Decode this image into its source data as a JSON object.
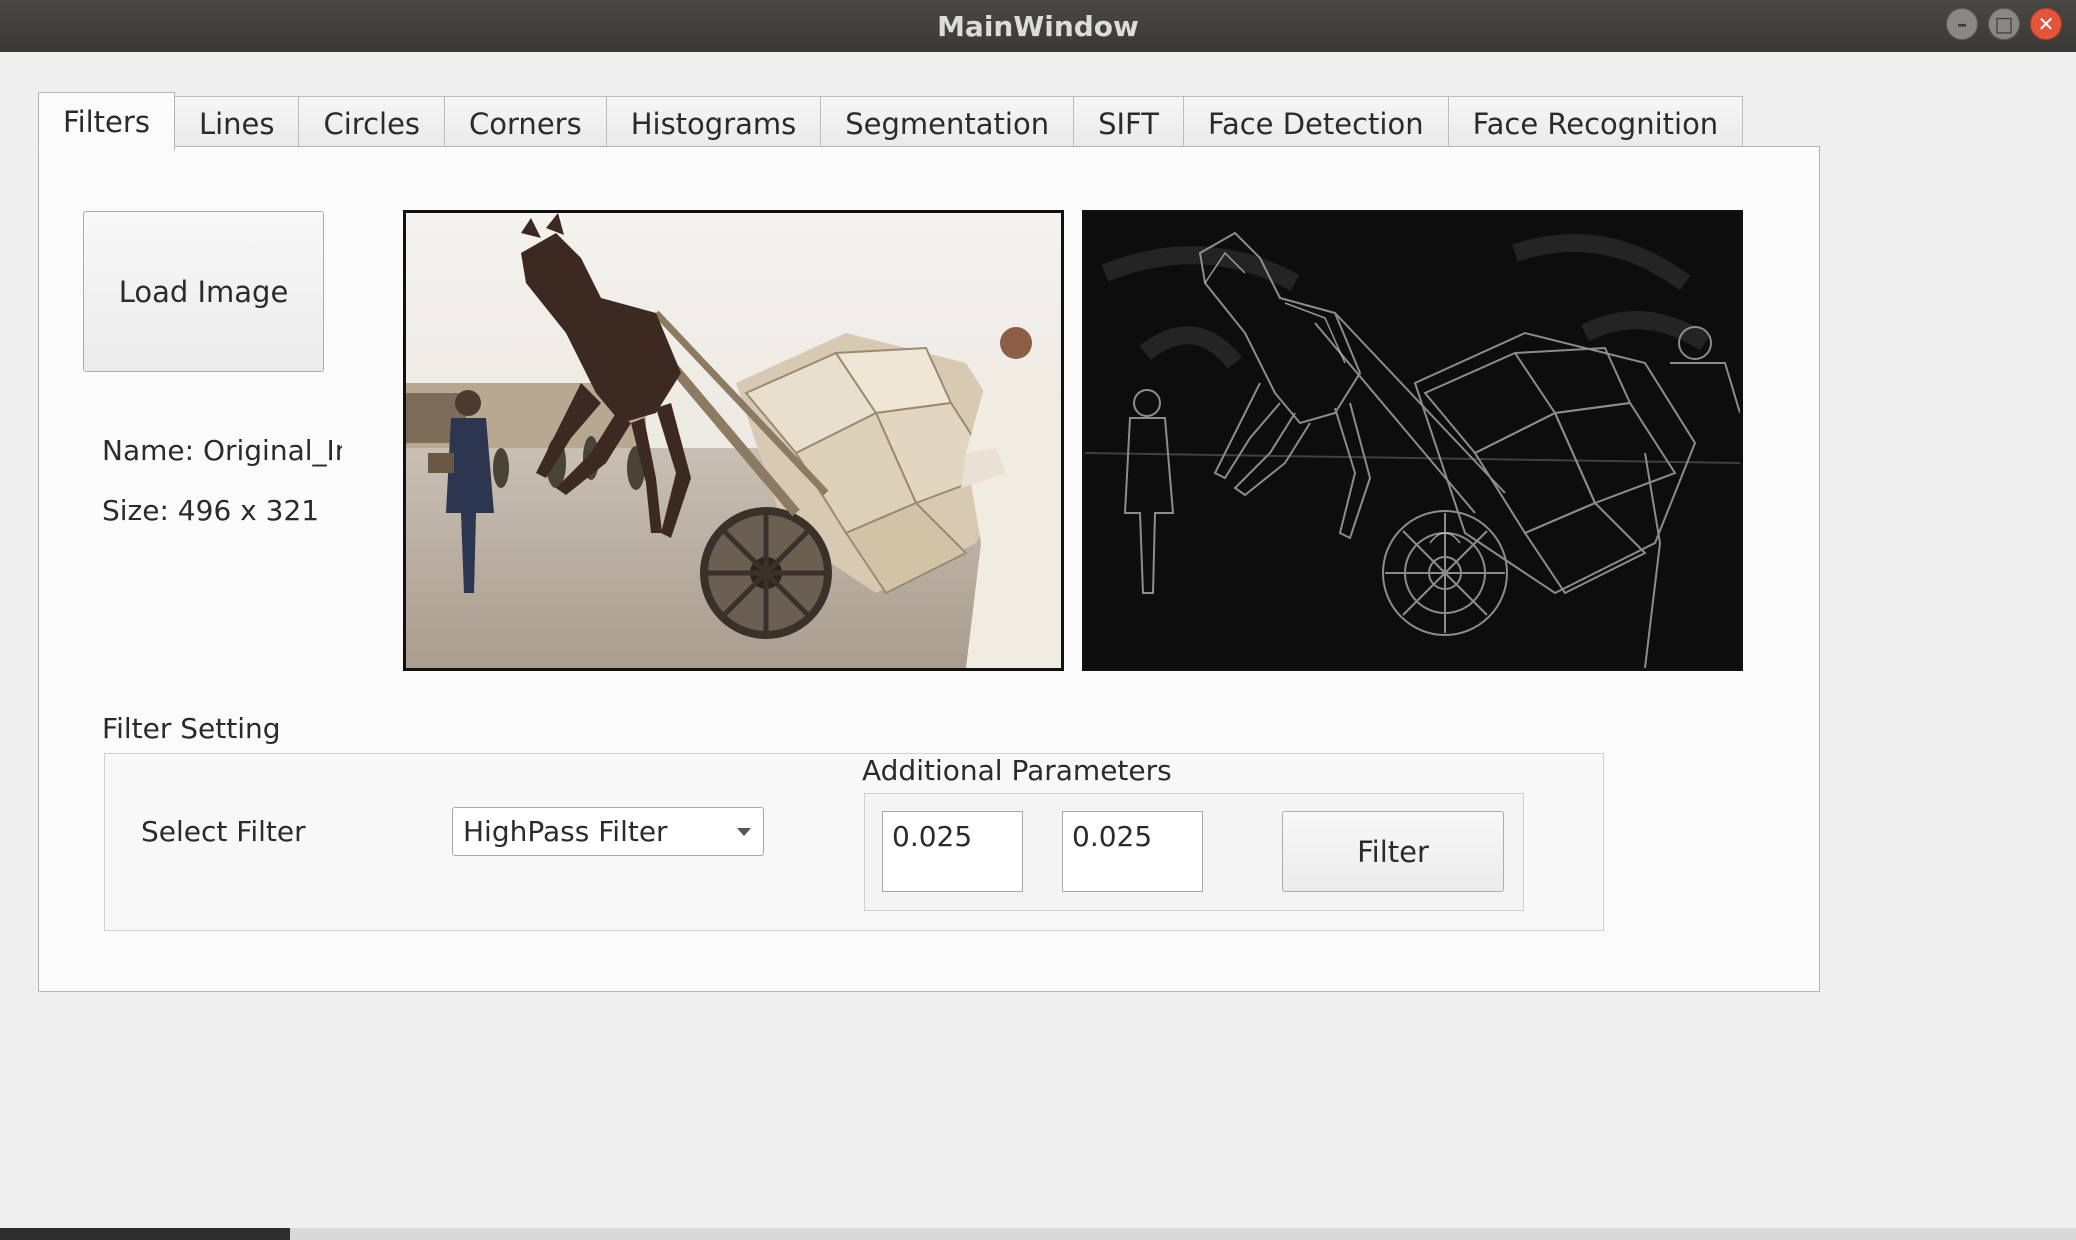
{
  "window": {
    "title": "MainWindow",
    "minimize_glyph": "–",
    "maximize_glyph": "□",
    "close_glyph": "✕"
  },
  "tabs": [
    {
      "label": "Filters",
      "active": true
    },
    {
      "label": "Lines"
    },
    {
      "label": "Circles"
    },
    {
      "label": "Corners"
    },
    {
      "label": "Histograms"
    },
    {
      "label": "Segmentation"
    },
    {
      "label": "SIFT"
    },
    {
      "label": "Face Detection"
    },
    {
      "label": "Face Recognition"
    }
  ],
  "filters_tab": {
    "load_button": "Load Image",
    "name_label": "Name:  Original_Image",
    "size_label": "Size: 496 x 321",
    "filter_setting_title": "Filter Setting",
    "select_filter_label": "Select Filter",
    "selected_filter": "HighPass Filter",
    "additional_parameters_title": "Additional Parameters",
    "param1_value": "0.025",
    "param2_value": "0.025",
    "filter_button": "Filter"
  }
}
